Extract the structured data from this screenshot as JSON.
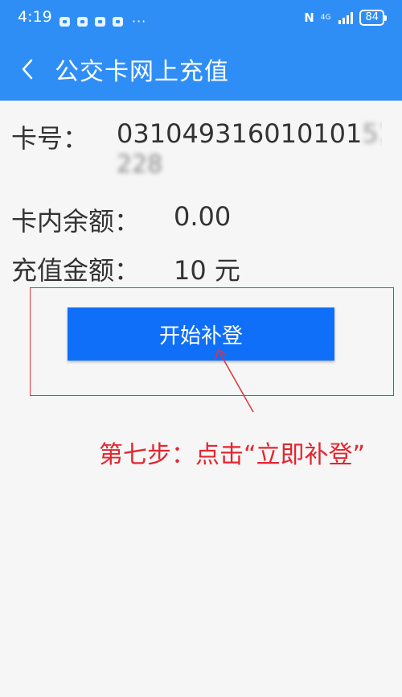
{
  "status_bar": {
    "time": "4:19",
    "more": "···",
    "nfc": "N",
    "network": "4G",
    "battery": "84"
  },
  "app_bar": {
    "title": "公交卡网上充值"
  },
  "card": {
    "number_label": "卡号：",
    "number_visible": "031049316010101",
    "number_blurred_tail": "51",
    "number_blurred_line2": "228",
    "balance_label": "卡内余额：",
    "balance_value": "0.00",
    "amount_label": "充值金额：",
    "amount_value": "10 元"
  },
  "actions": {
    "start_button_label": "开始补登"
  },
  "annotation": {
    "text": "第七步：点击“立即补登”",
    "color": "#e4252f"
  },
  "colors": {
    "header_blue": "#2f8ef5",
    "button_blue": "#0f6ff8",
    "annotation_red": "#e0323c"
  }
}
